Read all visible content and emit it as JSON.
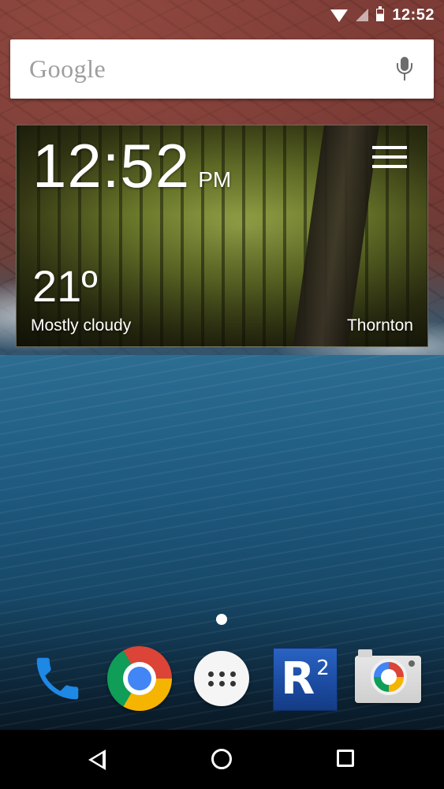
{
  "status_bar": {
    "time": "12:52",
    "icons": [
      "wifi-icon",
      "cell-signal-icon",
      "battery-icon"
    ]
  },
  "search_bar": {
    "logo_text": "Google",
    "mic_icon": "microphone-icon"
  },
  "clock_widget": {
    "time": "12:52",
    "ampm": "PM",
    "menu_icon": "hamburger-menu-icon",
    "temperature": "21º",
    "condition": "Mostly cloudy",
    "location": "Thornton"
  },
  "page_indicator": {
    "pages": 1,
    "current": 1
  },
  "dock": {
    "apps": [
      {
        "name": "Phone",
        "icon": "phone-icon"
      },
      {
        "name": "Chrome",
        "icon": "chrome-icon"
      },
      {
        "name": "Apps",
        "icon": "app-drawer-icon"
      },
      {
        "name": "R2",
        "icon": "r2-icon",
        "label_main": "R",
        "label_sup": "2"
      },
      {
        "name": "Camera",
        "icon": "camera-icon"
      }
    ]
  },
  "nav_bar": {
    "buttons": [
      "back-icon",
      "home-icon",
      "recents-icon"
    ]
  },
  "colors": {
    "phone_blue": "#1e88e5",
    "chrome_red": "#db4437",
    "chrome_yellow": "#f4b400",
    "chrome_green": "#0f9d58",
    "chrome_blue": "#4285f4",
    "r2_blue": "#1b4aa0",
    "nav_background": "#000000"
  }
}
